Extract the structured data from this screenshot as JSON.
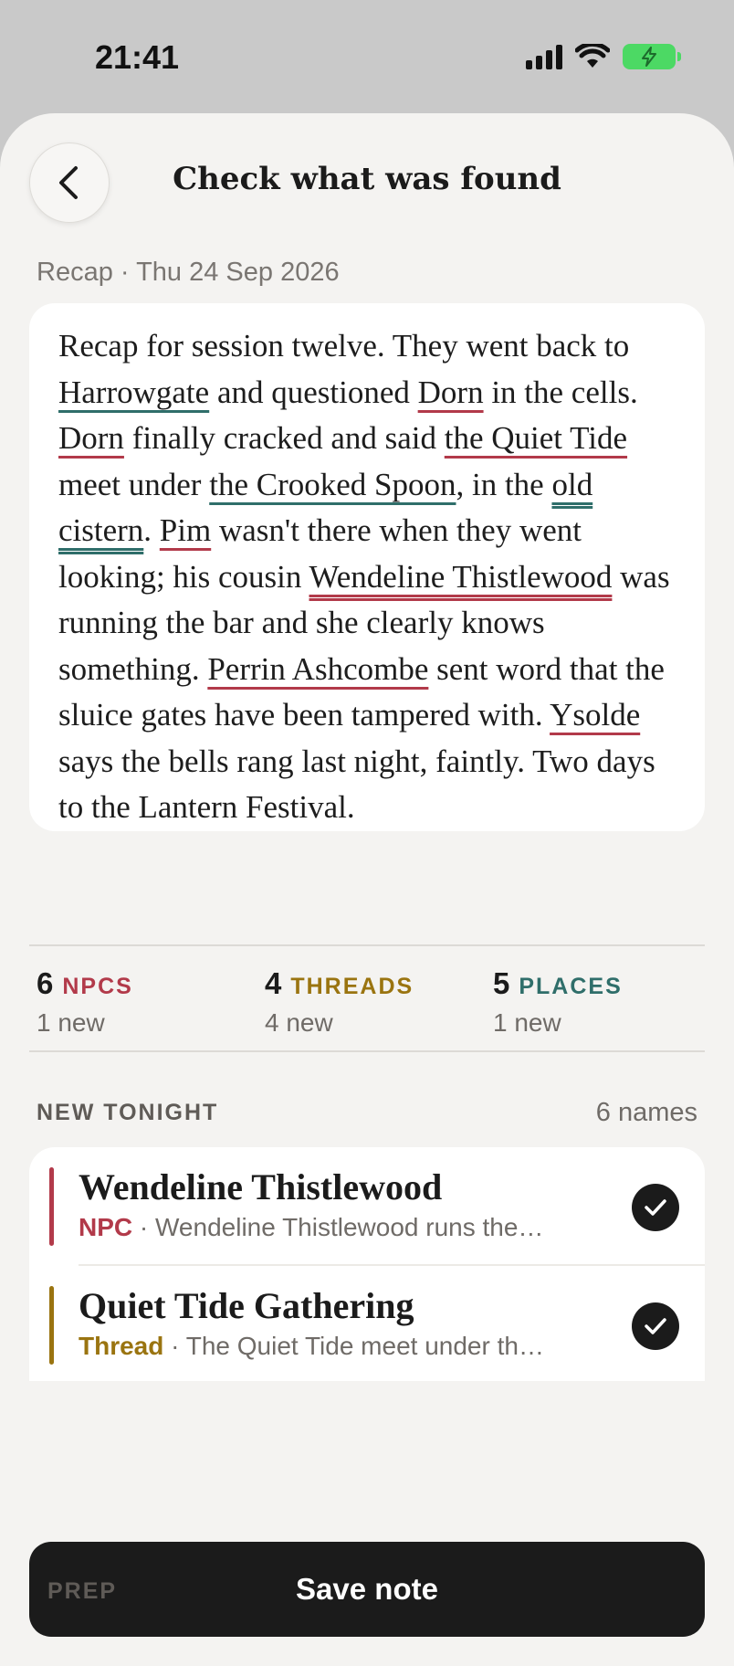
{
  "status": {
    "time": "21:41"
  },
  "header": {
    "title": "Check what was found"
  },
  "recap": {
    "meta": "Recap · Thu 24 Sep 2026",
    "segments": [
      {
        "t": "Recap for session twelve. They went back to ",
        "k": ""
      },
      {
        "t": "Harrowgate",
        "k": "place"
      },
      {
        "t": " and questioned ",
        "k": ""
      },
      {
        "t": "Dorn",
        "k": "npc"
      },
      {
        "t": " in the cells. ",
        "k": ""
      },
      {
        "t": "Dorn",
        "k": "npc"
      },
      {
        "t": " finally cracked and said ",
        "k": ""
      },
      {
        "t": "the Quiet Tide",
        "k": "npc"
      },
      {
        "t": " meet under ",
        "k": ""
      },
      {
        "t": "the Crooked Spoon",
        "k": "place"
      },
      {
        "t": ", in the ",
        "k": ""
      },
      {
        "t": "old cistern",
        "k": "place-new"
      },
      {
        "t": ". ",
        "k": ""
      },
      {
        "t": "Pim",
        "k": "npc"
      },
      {
        "t": " wasn't there when they went looking; his cousin ",
        "k": ""
      },
      {
        "t": "Wendeline Thistlewood",
        "k": "npc-new"
      },
      {
        "t": " was running the bar and she clearly knows something. ",
        "k": ""
      },
      {
        "t": "Perrin Ashcombe",
        "k": "npc"
      },
      {
        "t": " sent word that the sluice gates have been tampered with. ",
        "k": ""
      },
      {
        "t": "Ysolde",
        "k": "npc"
      },
      {
        "t": " says the bells rang last night, faintly. Two days to the Lantern Festival.",
        "k": ""
      }
    ]
  },
  "stats": {
    "npcs": {
      "count": "6",
      "label": "NPCS",
      "new": "1 new",
      "color": "#b23a4a"
    },
    "threads": {
      "count": "4",
      "label": "THREADS",
      "new": "4 new",
      "color": "#9a7410"
    },
    "places": {
      "count": "5",
      "label": "PLACES",
      "new": "1 new",
      "color": "#2f6e6a"
    }
  },
  "new_tonight": {
    "heading": "NEW TONIGHT",
    "count": "6 names",
    "items": [
      {
        "title": "Wendeline Thistlewood",
        "kind": "NPC",
        "summary": " · Wendeline Thistlewood runs the…",
        "color": "#b23a4a"
      },
      {
        "title": "Quiet Tide Gathering",
        "kind": "Thread",
        "summary": " · The Quiet Tide meet under th…",
        "color": "#9a7410"
      }
    ]
  },
  "actions": {
    "save_label": "Save note"
  },
  "peek": {
    "label": "PREP"
  }
}
